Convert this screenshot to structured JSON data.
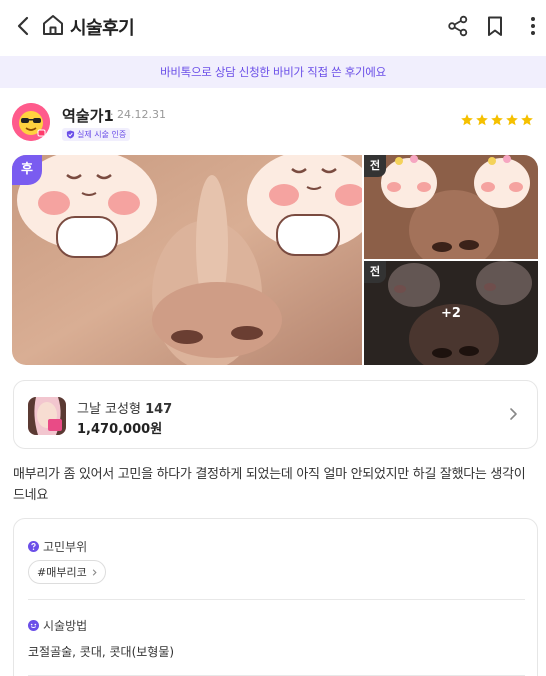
{
  "header": {
    "title": "시술후기"
  },
  "banner": {
    "text": "바비톡으로 상담 신청한 바비가 직접 쓴 후기에요"
  },
  "author": {
    "name": "역술가1",
    "date": "· 24.12.31",
    "verified_label": "실제 시술 인증",
    "rating": 5,
    "star_color": "#f5c000"
  },
  "gallery": {
    "after_label": "후",
    "before_label": "전",
    "more_count": "+2"
  },
  "product": {
    "name": "그날 코성형",
    "count": "147",
    "price": "1,470,000원"
  },
  "review": {
    "text": "매부리가 좀 있어서 고민을 하다가 결정하게 되었는데 아직 얼마 안되었지만 하길 잘했다는 생각이 드네요"
  },
  "details": {
    "concern_label": "고민부위",
    "concern_tag": "#매부리코",
    "procedure_label": "시술방법",
    "procedure_value": "코절골술, 콧대, 콧대(보형물)"
  },
  "colors": {
    "accent": "#6b4fe8",
    "after_badge": "#7a5cf0",
    "banner_bg": "#f1effd"
  }
}
